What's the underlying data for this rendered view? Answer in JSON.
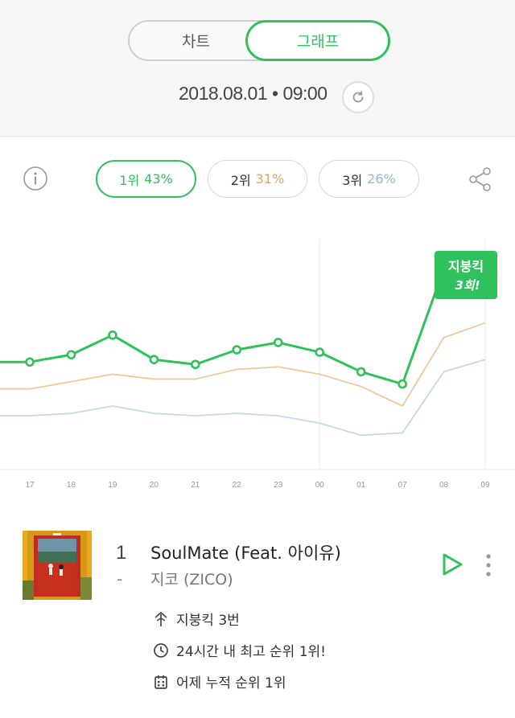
{
  "header": {
    "tab_chart": "차트",
    "tab_graph": "그래프",
    "timestamp": "2018.08.01 • 09:00"
  },
  "legend": {
    "rank1": {
      "label": "1위",
      "pct": "43%",
      "color": "#2fc15b"
    },
    "rank2": {
      "label": "2위",
      "pct": "31%",
      "color": "#e0a64f"
    },
    "rank3": {
      "label": "3위",
      "pct": "26%",
      "color": "#8cbad2"
    }
  },
  "chart_data": {
    "type": "line",
    "x": [
      "17",
      "18",
      "19",
      "20",
      "21",
      "22",
      "23",
      "00",
      "01",
      "07",
      "08",
      "09"
    ],
    "series": [
      {
        "values": [
          44,
          47,
          55,
          45,
          43,
          49,
          52,
          48,
          40,
          35,
          82,
          82
        ]
      },
      {
        "values": [
          33,
          36,
          39,
          37,
          37,
          41,
          42,
          39,
          34,
          26,
          54,
          60
        ]
      },
      {
        "values": [
          22,
          23,
          26,
          23,
          22,
          23,
          22,
          19,
          14,
          15,
          40,
          45
        ]
      }
    ],
    "colors": [
      "#2fc15b",
      "#f0c89a",
      "#c6d8ea"
    ],
    "ylim": [
      0,
      100
    ],
    "annotation": {
      "line1": "지붕킥",
      "line2": "3회!"
    }
  },
  "song": {
    "rank": "1",
    "rank_change": "-",
    "title": "SoulMate (Feat. 아이유)",
    "artist": "지코 (ZICO)",
    "stats": [
      {
        "icon": "roof-kick-icon",
        "text": "지붕킥 3번"
      },
      {
        "icon": "clock-icon",
        "text": "24시간 내 최고 순위 1위!"
      },
      {
        "icon": "calendar-icon",
        "text": "어제 누적 순위 1위"
      }
    ]
  }
}
